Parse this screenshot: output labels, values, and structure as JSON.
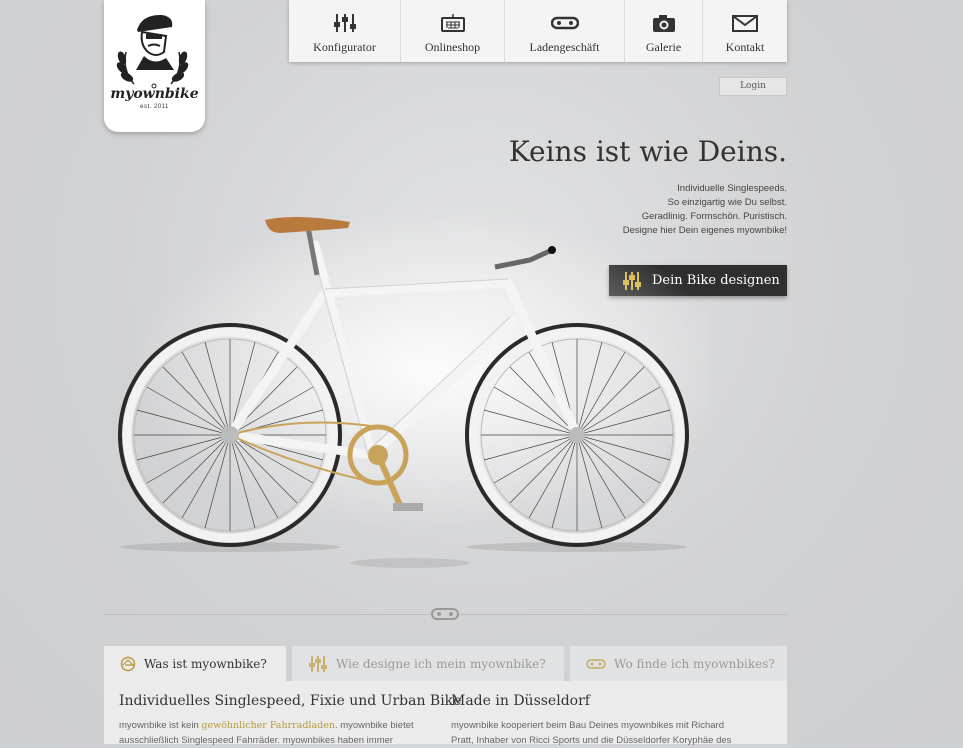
{
  "logo": {
    "wordmark": "myownbike",
    "est": "est. 2011"
  },
  "nav": {
    "items": [
      {
        "label": "Konfigurator",
        "icon": "sliders-icon"
      },
      {
        "label": "Onlineshop",
        "icon": "keyboard-icon"
      },
      {
        "label": "Ladengeschäft",
        "icon": "chain-link-icon"
      },
      {
        "label": "Galerie",
        "icon": "camera-icon"
      },
      {
        "label": "Kontakt",
        "icon": "envelope-icon"
      }
    ]
  },
  "login": "Login",
  "hero": {
    "headline": "Keins ist wie Deins.",
    "tagline": [
      "Individuelle Singlespeeds.",
      "So einzigartig wie Du selbst.",
      "Geradlinig. Formschön. Puristisch.",
      "Designe hier Dein eigenes myownbike!"
    ],
    "cta": "Dein Bike designen"
  },
  "tabs": [
    {
      "label": "Was ist myownbike?",
      "icon": "bike-wheel-icon",
      "active": true
    },
    {
      "label": "Wie designe ich mein myownbike?",
      "icon": "sliders-icon",
      "active": false
    },
    {
      "label": "Wo finde ich myownbikes?",
      "icon": "chain-link-icon",
      "active": false
    }
  ],
  "content": {
    "left": {
      "heading": "Individuelles Singlespeed, Fixie und Urban Bike",
      "text_before": "myownbike ist kein ",
      "highlight": "gewöhnlicher Fahrradladen",
      "text_after": ". myownbike bietet",
      "line2": "ausschließlich Singlespeed Fahrräder. myownbikes haben immer"
    },
    "right": {
      "heading": "Made in Düsseldorf",
      "line1": "myownbike kooperiert beim Bau Deines myownbikes mit Richard",
      "line2": "Pratt, Inhaber von Ricci Sports und die Düsseldorfer Koryphäe des"
    }
  },
  "colors": {
    "accent": "#b59a3c",
    "cta_bg": "#2f2f2f",
    "page_bg": "#d1d2d4"
  }
}
